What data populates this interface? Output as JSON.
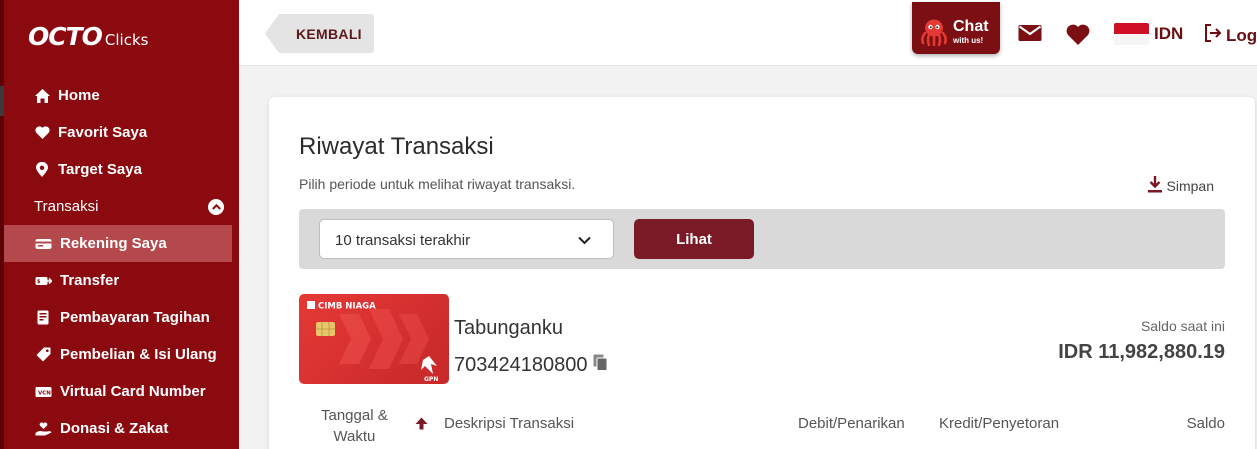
{
  "brand": {
    "logo_main": "OCTO",
    "logo_sub": "Clicks"
  },
  "sidebar": {
    "items": [
      {
        "label": "Home",
        "icon": "home-icon"
      },
      {
        "label": "Favorit Saya",
        "icon": "heart-icon"
      },
      {
        "label": "Target Saya",
        "icon": "target-pin-icon"
      }
    ],
    "section": {
      "label": "Transaksi",
      "icon": "chevron-up-icon"
    },
    "sub_items": [
      {
        "label": "Rekening Saya",
        "icon": "wallet-icon",
        "active": true
      },
      {
        "label": "Transfer",
        "icon": "transfer-icon"
      },
      {
        "label": "Pembayaran Tagihan",
        "icon": "bill-icon"
      },
      {
        "label": "Pembelian & Isi Ulang",
        "icon": "tag-icon"
      },
      {
        "label": "Virtual Card Number",
        "icon": "vcn-icon"
      },
      {
        "label": "Donasi & Zakat",
        "icon": "donation-hand-icon"
      }
    ]
  },
  "topbar": {
    "back_label": "KEMBALI",
    "chat_title": "Chat",
    "chat_sub": "with us!",
    "language": "IDN",
    "logout_label": "Logout"
  },
  "page": {
    "title": "Riwayat Transaksi",
    "subtitle": "Pilih periode untuk melihat riwayat transaksi.",
    "save_label": "Simpan",
    "period_selected": "10 transaksi terakhir",
    "view_button": "Lihat"
  },
  "account": {
    "card_brand": "CIMB NIAGA",
    "card_network": "GPN",
    "name": "Tabunganku",
    "number": "703424180800",
    "balance_label": "Saldo saat ini",
    "balance_value": "IDR 11,982,880.19"
  },
  "table": {
    "headers": {
      "date_line1": "Tanggal &",
      "date_line2": "Waktu",
      "description": "Deskripsi Transaksi",
      "debit": "Debit/Penarikan",
      "credit": "Kredit/Penyetoran",
      "balance": "Saldo"
    }
  },
  "colors": {
    "brand": "#8a0a0f",
    "active": "#b3494c",
    "button": "#7b1a27"
  }
}
